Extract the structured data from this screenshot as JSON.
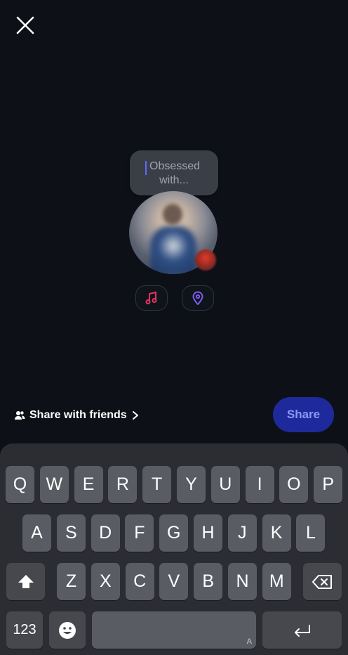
{
  "compose": {
    "note_placeholder": "Obsessed with...",
    "music_icon": "music-note-icon",
    "location_icon": "location-pin-icon"
  },
  "footer": {
    "share_with_friends_label": "Share with friends",
    "share_button_label": "Share"
  },
  "keyboard": {
    "row1": [
      "Q",
      "W",
      "E",
      "R",
      "T",
      "Y",
      "U",
      "I",
      "O",
      "P"
    ],
    "row2": [
      "A",
      "S",
      "D",
      "F",
      "G",
      "H",
      "J",
      "K",
      "L"
    ],
    "row3": [
      "Z",
      "X",
      "C",
      "V",
      "B",
      "N",
      "M"
    ],
    "numbers_label": "123",
    "space_hint": "A"
  },
  "colors": {
    "background": "#0d1117",
    "accent_share": "#1e2a9c",
    "music_icon": "#e8335f",
    "location_icon": "#7c5cf0"
  }
}
